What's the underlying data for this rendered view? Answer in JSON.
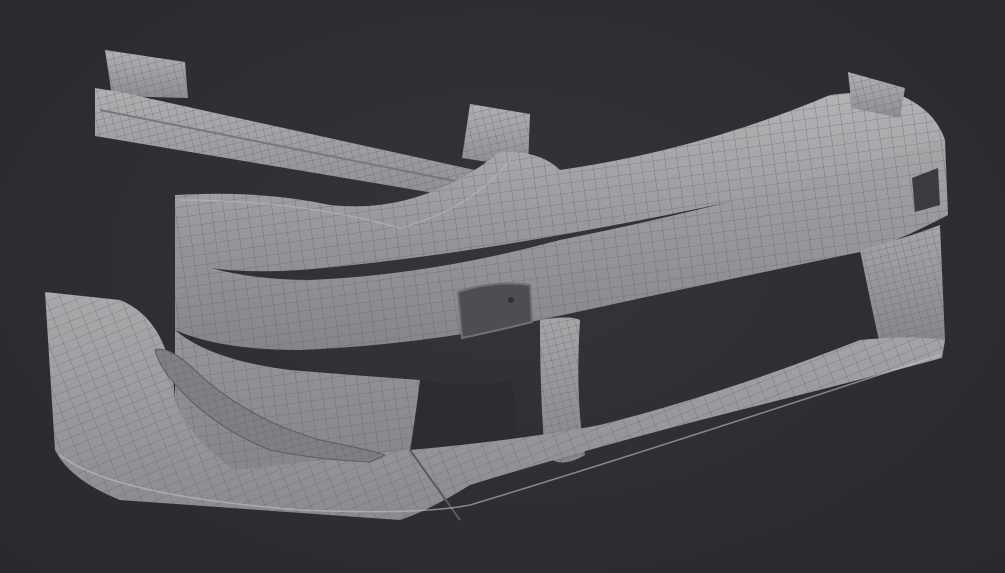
{
  "viewport": {
    "background_color": "#2e2f31",
    "mesh_fill_color": "#9a9b9d",
    "mesh_shadow_color": "#6e6f72",
    "mesh_highlight_color": "#b8b9bb",
    "wire_color": "#55565a",
    "show_wireframe": true,
    "objects": [
      {
        "id": "roof-spoiler",
        "icon": "mesh-object-icon"
      },
      {
        "id": "front-bumper",
        "icon": "mesh-object-icon"
      },
      {
        "id": "bumper-canard",
        "icon": "mesh-object-icon"
      }
    ]
  }
}
